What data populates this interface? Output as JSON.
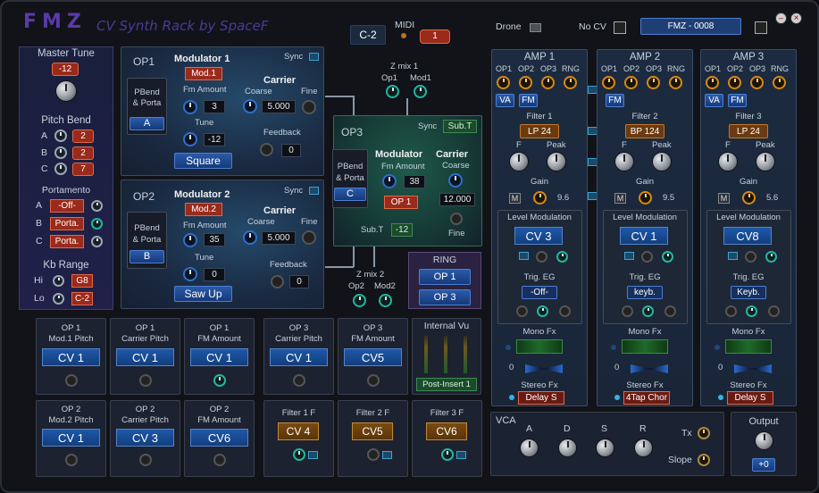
{
  "header": {
    "logo": "FMZ",
    "subtitle": "CV Synth Rack  by SpaceF",
    "midi_label": "MIDI",
    "note": "C-2",
    "midi_ch": "1",
    "drone": "Drone",
    "nocv": "No CV",
    "preset": "FMZ - 0008"
  },
  "master": {
    "title": "Master Tune",
    "value": "-12",
    "pitchbend": "Pitch Bend",
    "pb": [
      {
        "k": "A",
        "v": "2"
      },
      {
        "k": "B",
        "v": "2"
      },
      {
        "k": "C",
        "v": "7"
      }
    ],
    "portamento": "Portamento",
    "porta": [
      {
        "k": "A",
        "v": "-Off-"
      },
      {
        "k": "B",
        "v": "Porta."
      },
      {
        "k": "C",
        "v": "Porta."
      }
    ],
    "kbrange": "Kb Range",
    "hi": "Hi",
    "hi_v": "G8",
    "lo": "Lo",
    "lo_v": "C-2"
  },
  "op1": {
    "name": "OP1",
    "mod": "Modulator 1",
    "sync": "Sync",
    "pbend": "PBend",
    "porta": "& Porta",
    "ch": "A",
    "mod_btn": "Mod.1",
    "fm": "Fm Amount",
    "fm_v": "3",
    "tune": "Tune",
    "tune_v": "-12",
    "wave": "Square",
    "carrier": "Carrier",
    "coarse": "Coarse",
    "fine": "Fine",
    "coarse_v": "5.000",
    "feedback": "Feedback",
    "fb_v": "0"
  },
  "op2": {
    "name": "OP2",
    "mod": "Modulator 2",
    "sync": "Sync",
    "pbend": "PBend",
    "porta": "& Porta",
    "ch": "B",
    "mod_btn": "Mod.2",
    "fm": "Fm Amount",
    "fm_v": "35",
    "tune": "Tune",
    "tune_v": "0",
    "wave": "Saw Up",
    "carrier": "Carrier",
    "coarse": "Coarse",
    "fine": "Fine",
    "coarse_v": "5.000",
    "feedback": "Feedback",
    "fb_v": "0"
  },
  "op3": {
    "name": "OP3",
    "sync": "Sync",
    "sync_v": "Sub.T",
    "pbend": "PBend",
    "porta": "& Porta",
    "ch": "C",
    "mod": "Modulator",
    "fm": "Fm Amount",
    "fm_v": "38",
    "op_btn": "OP 1",
    "carrier": "Carrier",
    "coarse": "Coarse",
    "coarse_v": "12.000",
    "fine": "Fine",
    "subt": "Sub.T",
    "subt_v": "-12"
  },
  "zmix1": {
    "title": "Z mix 1",
    "a": "Op1",
    "b": "Mod1"
  },
  "zmix2": {
    "title": "Z mix 2",
    "a": "Op2",
    "b": "Mod2"
  },
  "ring": {
    "title": "RING",
    "a": "OP 1",
    "b": "OP 3"
  },
  "cvrow1": [
    {
      "t1": "OP 1",
      "t2": "Mod.1 Pitch",
      "v": "CV 1"
    },
    {
      "t1": "OP 1",
      "t2": "Carrier Pitch",
      "v": "CV 1"
    },
    {
      "t1": "OP 1",
      "t2": "FM Amount",
      "v": "CV 1"
    },
    {
      "t1": "OP 3",
      "t2": "Carrier Pitch",
      "v": "CV 1"
    },
    {
      "t1": "OP 3",
      "t2": "FM Amount",
      "v": "CV5"
    }
  ],
  "cvrow2": [
    {
      "t1": "OP 2",
      "t2": "Mod.2 Pitch",
      "v": "CV 1"
    },
    {
      "t1": "OP 2",
      "t2": "Carrier Pitch",
      "v": "CV 3"
    },
    {
      "t1": "OP 2",
      "t2": "FM Amount",
      "v": "CV6"
    }
  ],
  "filtercv": [
    {
      "t": "Filter 1 F",
      "v": "CV 4"
    },
    {
      "t": "Filter 2 F",
      "v": "CV5"
    },
    {
      "t": "Filter 3 F",
      "v": "CV6"
    }
  ],
  "vu": {
    "title": "Internal Vu",
    "btn": "Post-Insert 1"
  },
  "amps": [
    {
      "title": "AMP 1",
      "ops": [
        "OP1",
        "OP2",
        "OP3",
        "RNG"
      ],
      "va": "VA",
      "fm": "FM",
      "filter": "Filter 1",
      "ftype": "LP 24",
      "f": "F",
      "peak": "Peak",
      "gain": "Gain",
      "m": "M",
      "gain_v": "9.6",
      "lvl": "Level Modulation",
      "cv": "CV 3",
      "trig": "Trig. EG",
      "trig_v": "-Off-",
      "monofx": "Mono Fx",
      "zero": "0",
      "stereo": "Stereo Fx",
      "stereo_v": "Delay S"
    },
    {
      "title": "AMP 2",
      "ops": [
        "OP1",
        "OP2",
        "OP3",
        "RNG"
      ],
      "va": "",
      "fm": "FM",
      "filter": "Filter 2",
      "ftype": "BP 124",
      "f": "F",
      "peak": "Peak",
      "gain": "Gain",
      "m": "M",
      "gain_v": "9.5",
      "lvl": "Level Modulation",
      "cv": "CV 1",
      "trig": "Trig. EG",
      "trig_v": "keyb.",
      "monofx": "Mono Fx",
      "zero": "0",
      "stereo": "Stereo Fx",
      "stereo_v": "4Tap Chor"
    },
    {
      "title": "AMP 3",
      "ops": [
        "OP1",
        "OP2",
        "OP3",
        "RNG"
      ],
      "va": "VA",
      "fm": "FM",
      "filter": "Filter 3",
      "ftype": "LP 24",
      "f": "F",
      "peak": "Peak",
      "gain": "Gain",
      "m": "M",
      "gain_v": "5.6",
      "lvl": "Level Modulation",
      "cv": "CV8",
      "trig": "Trig. EG",
      "trig_v": "Keyb.",
      "monofx": "Mono Fx",
      "zero": "0",
      "stereo": "Stereo Fx",
      "stereo_v": "Delay S"
    }
  ],
  "vca": {
    "title": "VCA",
    "a": "A",
    "d": "D",
    "s": "S",
    "r": "R",
    "tx": "Tx",
    "slope": "Slope"
  },
  "output": {
    "title": "Output",
    "v": "+0"
  }
}
